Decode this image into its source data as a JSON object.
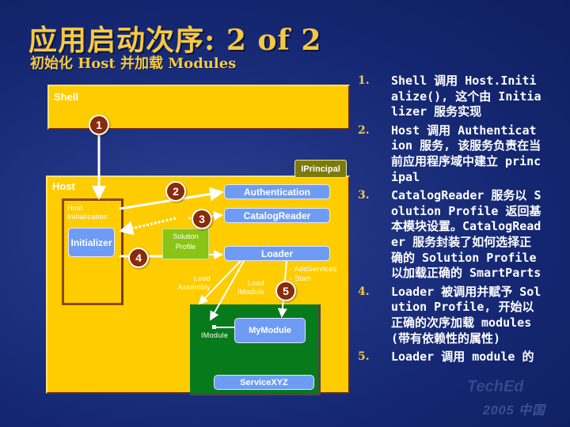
{
  "slide": {
    "title": "应用启动次序: 2 of 2",
    "subtitle": "初始化 Host 并加载 Modules"
  },
  "diagram": {
    "shell_label": "Shell",
    "host_label": "Host",
    "host_initialization_label": "Host Initialization",
    "initializer_label": "Initializer",
    "iprincipal_label": "IPrincipal",
    "authentication_label": "Authentication",
    "catalog_reader_label": "CatalogReader",
    "loader_label": "Loader",
    "solution_profile_label": "Solution Profile",
    "load_assembly_label": "Load Assembly",
    "load_imodule_label": "Load IModule",
    "add_services_label": "- AddServices",
    "start_label": "- Start",
    "imodule_label": "IModule",
    "mymodule_label": "MyModule",
    "service_label": "ServiceXYZ",
    "badges": [
      "1",
      "2",
      "3",
      "4",
      "5"
    ],
    "colors": {
      "container_fill": "#ffcc00",
      "component_fill": "#6e9cf4",
      "module_area_fill": "#077a1c",
      "badge_fill": "#8a2b0a",
      "profile_fill": "#8ac417",
      "title_color": "#f7c942"
    }
  },
  "steps": [
    {
      "num": "1.",
      "text": "Shell 调用 Host.Initialize(), 这个由 Initializer 服务实现"
    },
    {
      "num": "2.",
      "text": "Host 调用 Authentication 服务, 该服务负责在当前应用程序域中建立 principal"
    },
    {
      "num": "3.",
      "text": "CatalogReader 服务以 Solution Profile 返回基本模块设置。CatalogReader 服务封装了如何选择正确的 Solution Profile 以加载正确的 SmartParts"
    },
    {
      "num": "4.",
      "text": "Loader 被调用并赋予 Solution Profile, 开始以正确的次序加载 modules (带有依赖性的属性)"
    },
    {
      "num": "5.",
      "text": "Loader 调用 module 的"
    }
  ],
  "watermark": {
    "logo": "TechEd",
    "text": "2005 中国"
  }
}
